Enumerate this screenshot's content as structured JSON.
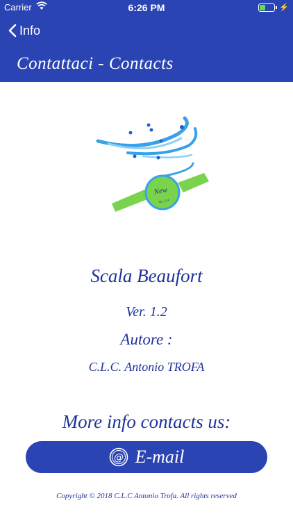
{
  "status_bar": {
    "carrier": "Carrier",
    "time": "6:26 PM",
    "battery_level": 0.4,
    "icons": [
      "wifi-icon",
      "battery-icon",
      "charging-bolt-icon"
    ]
  },
  "nav": {
    "back_label": "Info",
    "title": "Contattaci - Contacts"
  },
  "logo": {
    "badge_text": "New",
    "badge_small": "Ver. 1.4"
  },
  "info": {
    "app_name": "Scala Beaufort",
    "version": "Ver. 1.2",
    "author_label": "Autore :",
    "author_name": "C.L.C. Antonio TROFA",
    "more_info": "More info contacts us:"
  },
  "email_button": {
    "label": "E-mail",
    "icon": "at-sign-icon"
  },
  "footer": {
    "copyright": "Copyright © 2018 C.L.C Antonio Trofa. All rights reserved"
  },
  "colors": {
    "header": "#2a44b4",
    "text": "#1e3399",
    "button": "#2a44b4",
    "badge_green": "#6fd45a",
    "wave_blue": "#3aa0e8"
  }
}
